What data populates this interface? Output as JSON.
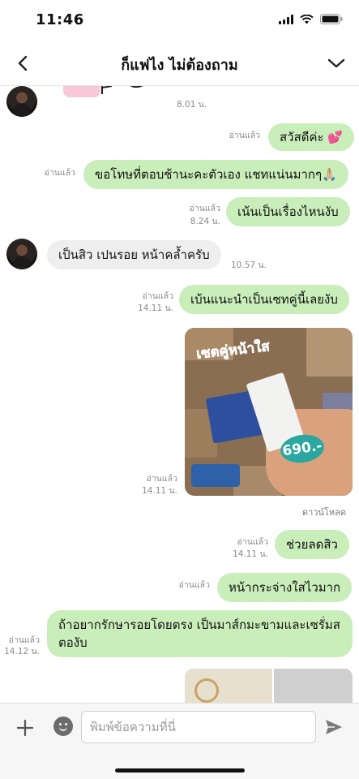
{
  "status_bar": {
    "time": "11:46"
  },
  "header": {
    "title": "ก็แฟไง ไม่ต้องถาม"
  },
  "messages": {
    "m0": {
      "time": "8.01 น."
    },
    "m1": {
      "read": "อ่านแล้ว",
      "text": "สวัสดีค่ะ 💕"
    },
    "m2": {
      "read": "อ่านแล้ว",
      "text": "ขอโทษที่ตอบช้านะคะตัวเอง แชทแน่นมากๆ🙏🏼"
    },
    "m3": {
      "read": "อ่านแล้ว",
      "time": "8.24 น.",
      "text": "เน้นเป็นเรื่องไหนงับ"
    },
    "m4": {
      "text": "เป็นสิว เปนรอย หน้าคล้ำครับ",
      "time": "10.57 น."
    },
    "m5": {
      "read": "อ่านแล้ว",
      "time": "14.11 น.",
      "text": "เบ้นแนะนำเป็นเซทคู่นี้เลยงับ"
    },
    "m6": {
      "read": "อ่านแล้ว",
      "time": "14.11 น.",
      "image_text": "เซตคู่หน้าใส",
      "price": "690.-",
      "download": "ดาวน์โหลด"
    },
    "m7": {
      "read": "อ่านแล้ว",
      "time": "14.11 น.",
      "text": "ช่วยลดสิว"
    },
    "m8": {
      "read": "อ่านแล้ว",
      "text": "หน้ากระจ่างใสไวมาก"
    },
    "m9": {
      "read": "อ่านแล้ว",
      "time": "14.12 น.",
      "text": "ถ้าอยากรักษารอยโดยตรง เป็นมาส์กมะขามและเซรั่มสตองับ"
    }
  },
  "input": {
    "placeholder": "พิมพ์ข้อความที่นี่"
  },
  "colors": {
    "outgoing_bubble": "#c9eeba",
    "incoming_bubble": "#eeeeee",
    "meta_text": "#8a8a8a"
  },
  "icons": [
    "back-icon",
    "chevron-down-icon",
    "plus-icon",
    "emoji-icon",
    "send-icon",
    "signal-icon",
    "wifi-icon",
    "battery-icon"
  ]
}
